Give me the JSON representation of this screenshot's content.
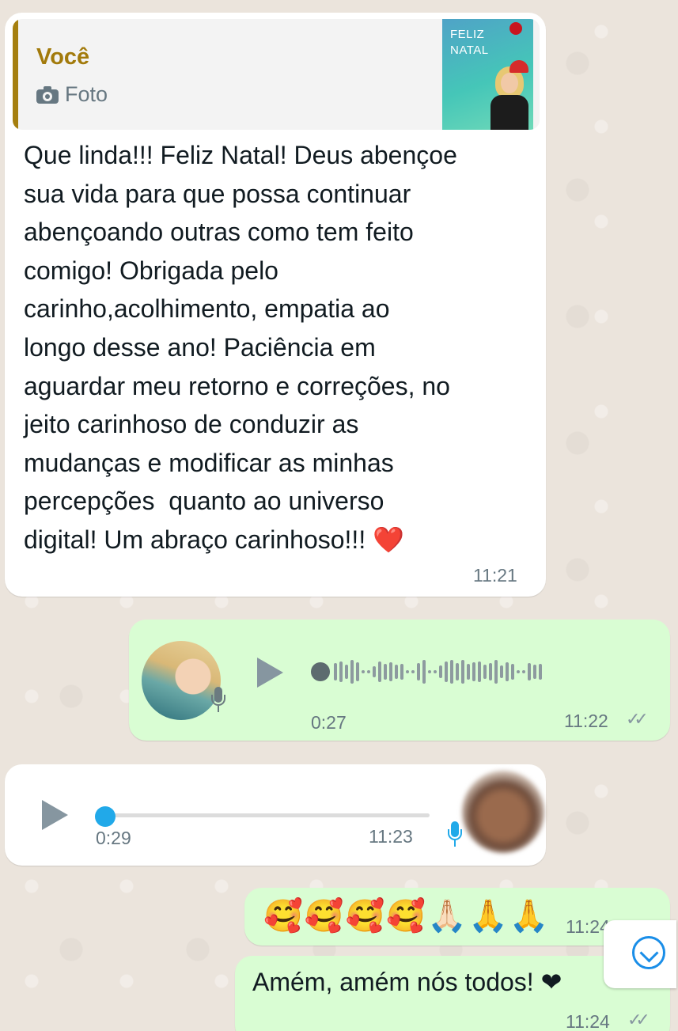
{
  "messages": {
    "m1": {
      "quote_author": "Você",
      "quote_type": "Foto",
      "quote_icon": "camera-icon",
      "thumb_title": "FELIZ\nNATAL",
      "text": "Que linda!!! Feliz Natal! Deus abençoe\nsua vida para que possa continuar\nabençoando outras como tem feito\ncomigo! Obrigada pelo\ncarinho,acolhimento, empatia ao\nlongo desse ano! Paciência em\naguardar meu retorno e correções, no\njeito carinhoso de conduzir as\nmudanças e modificar as minhas\npercepções  quanto ao universo\ndigital! Um abraço carinhoso!!! ",
      "heart": "❤️",
      "time": "11:21"
    },
    "m2": {
      "duration": "0:27",
      "time": "11:22",
      "status": "read"
    },
    "m3": {
      "duration": "0:29",
      "time": "11:23"
    },
    "m4": {
      "emojis": "🥰🥰🥰🥰🙏🏻🙏🙏",
      "time": "11:24"
    },
    "m5": {
      "text": "Amém, amém nós todos! ❤",
      "time": "11:24",
      "status": "read"
    }
  },
  "colors": {
    "incoming_bubble": "#ffffff",
    "outgoing_bubble": "#d9fdd3",
    "quote_accent": "#a57f0f",
    "play_progress": "#21a9e9"
  }
}
